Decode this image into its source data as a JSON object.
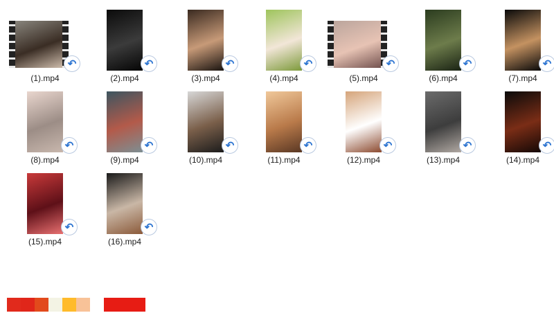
{
  "files": [
    {
      "label": "(1).mp4",
      "style": "wide",
      "colors": [
        "#8d8a82",
        "#3a2d24",
        "#d8c6b5"
      ]
    },
    {
      "label": "(2).mp4",
      "style": "tall",
      "colors": [
        "#0b0b0b",
        "#3b3b3b",
        "#050505"
      ]
    },
    {
      "label": "(3).mp4",
      "style": "tall",
      "colors": [
        "#3a2a20",
        "#c79a78",
        "#1a1410"
      ]
    },
    {
      "label": "(4).mp4",
      "style": "tall",
      "colors": [
        "#9ec45c",
        "#f2e6d8",
        "#7d9a3b"
      ]
    },
    {
      "label": "(5).mp4",
      "style": "wide",
      "colors": [
        "#b8a39b",
        "#e7c3b4",
        "#6b4a48"
      ]
    },
    {
      "label": "(6).mp4",
      "style": "tall",
      "colors": [
        "#2b3c1f",
        "#6d7c4b",
        "#1a2314"
      ]
    },
    {
      "label": "(7).mp4",
      "style": "tall",
      "colors": [
        "#0a0a0a",
        "#c49261",
        "#0a0a0a"
      ]
    },
    {
      "label": "(8).mp4",
      "style": "tall",
      "colors": [
        "#e9d6ce",
        "#9c8d86",
        "#c8b7ad"
      ]
    },
    {
      "label": "(9).mp4",
      "style": "tall",
      "colors": [
        "#3d5560",
        "#b35a4a",
        "#7d8e92"
      ]
    },
    {
      "label": "(10).mp4",
      "style": "tall",
      "colors": [
        "#d7d7d7",
        "#7a5f4a",
        "#1c1c1c"
      ]
    },
    {
      "label": "(11).mp4",
      "style": "tall",
      "colors": [
        "#f0c89a",
        "#b97a4a",
        "#5a3824"
      ]
    },
    {
      "label": "(12).mp4",
      "style": "tall",
      "colors": [
        "#d5a47a",
        "#ffffff",
        "#8c4a2f"
      ]
    },
    {
      "label": "(13).mp4",
      "style": "tall",
      "colors": [
        "#6b6b6b",
        "#3d3d3d",
        "#b0a8a2"
      ]
    },
    {
      "label": "(14).mp4",
      "style": "tall",
      "colors": [
        "#0a0a0a",
        "#7a2d16",
        "#140806"
      ]
    },
    {
      "label": "(15).mp4",
      "style": "tall",
      "colors": [
        "#c83a3a",
        "#5e1018",
        "#e87070"
      ]
    },
    {
      "label": "(16).mp4",
      "style": "tall",
      "colors": [
        "#1a1a1a",
        "#c9b7a6",
        "#8b5a3a"
      ]
    }
  ],
  "shortcut_icon": "shortcut-arrow-icon",
  "taskbar_colors": [
    "#e12a1c",
    "#e0261a",
    "#e24a1c",
    "#f3f3e4",
    "#ffbb2b",
    "#f8c298",
    "#ffffff",
    "#e71c14"
  ]
}
